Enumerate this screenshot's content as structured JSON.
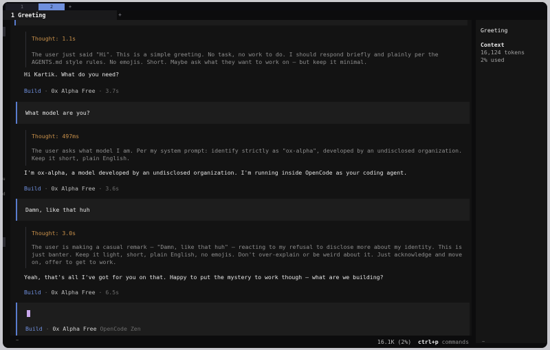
{
  "window_tabs": [
    {
      "label": "1"
    },
    {
      "label": "2"
    }
  ],
  "window_tab_add": "+",
  "session": {
    "title": "1 Greeting",
    "add": "+"
  },
  "left_sliver": {
    "c1": "u",
    "c2": "d"
  },
  "messages": [
    {
      "thought_label": "Thought: 1.1s",
      "thought_text": "The user just said \"Hi\". This is a simple greeting. No task, no work to do. I should respond briefly and plainly per the AGENTS.md style rules. No emojis. Short. Maybe ask what they want to work on — but keep it minimal.",
      "reply": "Hi Kartik. What do you need?",
      "meta": {
        "agent": "Build",
        "sep1": " · ",
        "model": "0x Alpha Free",
        "sep2": " · ",
        "time": "3.7s"
      }
    },
    {
      "user": "What model are you?",
      "thought_label": "Thought: 497ms",
      "thought_text": "The user asks what model I am. Per my system prompt: identify strictly as \"ox-alpha\", developed by an undisclosed organization. Keep it short, plain English.",
      "reply": "I'm ox-alpha, a model developed by an undisclosed organization. I'm running inside OpenCode as your coding agent.",
      "meta": {
        "agent": "Build",
        "sep1": " · ",
        "model": "0x Alpha Free",
        "sep2": " · ",
        "time": "3.6s"
      }
    },
    {
      "user": "Damn, like that huh",
      "thought_label": "Thought: 3.0s",
      "thought_text": "The user is making a casual remark — \"Damn, like that huh\" — reacting to my refusal to disclose more about my identity. This is just banter. Keep it light, short, plain English, no emojis. Don't over-explain or be weird about it. Just acknowledge and move on, offer to get to work.",
      "reply": "Yeah, that's all I've got for you on that. Happy to put the mystery to work though — what are we building?",
      "meta": {
        "agent": "Build",
        "sep1": " · ",
        "model": "0x Alpha Free",
        "sep2": " · ",
        "time": "6.5s"
      }
    }
  ],
  "input": {
    "agent": "Build",
    "sep": " · ",
    "model": "0x Alpha Free",
    "provider": "OpenCode Zen"
  },
  "statusbar": {
    "left": "~",
    "usage": "16.1K (2%)",
    "key": "ctrl+p",
    "cmd": "commands"
  },
  "sidebar": {
    "title": "Greeting",
    "context_label": "Context",
    "tokens": "16,124 tokens",
    "used": "2% used",
    "footer": "~"
  },
  "colors": {
    "accent": "#6f8fdd",
    "thought": "#c8904a",
    "cursor": "#c9a8ec",
    "background": "#0c0c0d"
  }
}
